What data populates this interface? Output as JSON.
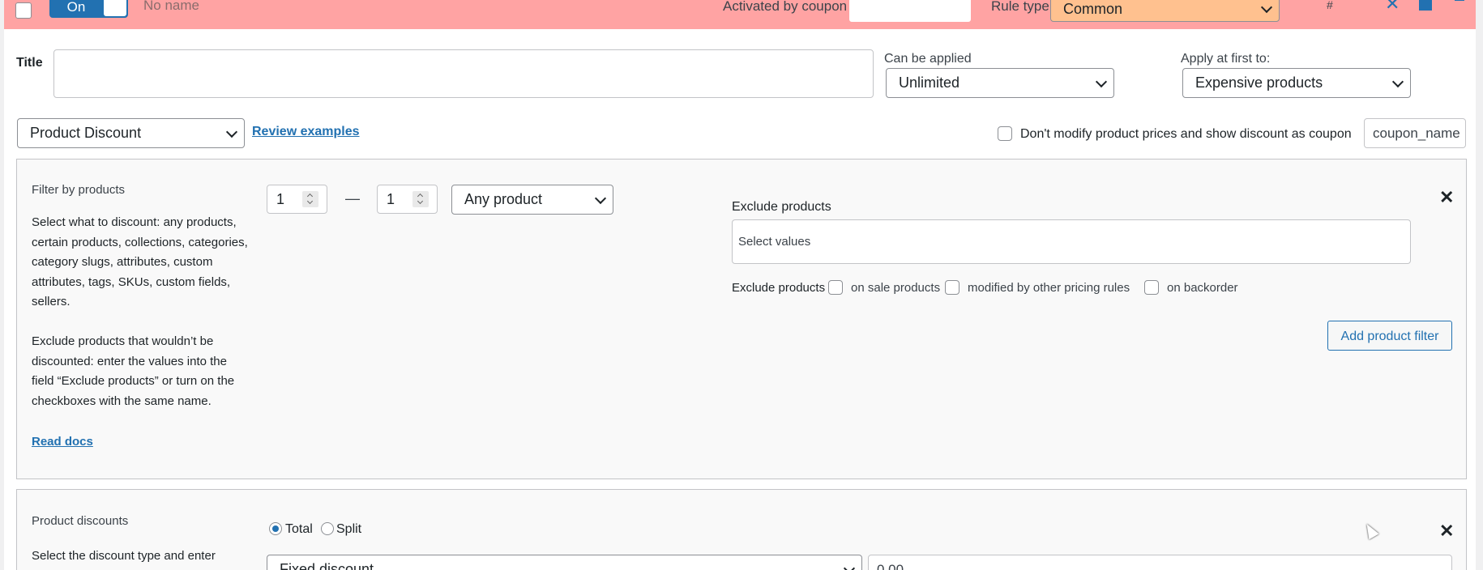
{
  "header": {
    "toggle_label": "On",
    "rule_name_placeholder": "No name",
    "coupon_label": "Activated by coupon",
    "coupon_value": "",
    "rule_type_label": "Rule type",
    "rule_type_value": "Common",
    "hash_label": "#",
    "bg_color": "#ffa3a3",
    "rule_type_bg": "#ffc18f"
  },
  "title_row": {
    "title_label": "Title",
    "title_value": "",
    "can_be_applied_label": "Can be applied",
    "can_be_applied_value": "Unlimited",
    "apply_first_label": "Apply at first to:",
    "apply_first_value": "Expensive products"
  },
  "rule_type_row": {
    "discount_type_value": "Product Discount",
    "review_examples_link": "Review examples",
    "dont_modify_label": "Don't modify product prices and show discount as coupon",
    "coupon_name_value": "coupon_name"
  },
  "filter_section": {
    "title": "Filter by products",
    "desc_1": "Select what to discount: any products, certain products, collections, categories, category slugs, attributes, custom attributes, tags, SKUs, custom fields, sellers.",
    "desc_2": "Exclude products that wouldn’t be discounted: enter the values into the field “Exclude products” or turn on the checkboxes with the same name.",
    "read_docs_link": "Read docs",
    "qty_from": "1",
    "qty_separator": "—",
    "qty_to": "1",
    "product_type_value": "Any product",
    "exclude_label": "Exclude products",
    "exclude_placeholder": "Select values",
    "exclude_checks_label": "Exclude products",
    "on_sale_label": "on sale products",
    "modified_label": "modified by other pricing rules",
    "backorder_label": "on backorder",
    "add_filter_button": "Add product filter"
  },
  "discount_section": {
    "title": "Product discounts",
    "desc": "Select the discount type and enter",
    "radio_total": "Total",
    "radio_split": "Split",
    "discount_type_value": "Fixed discount",
    "amount_value": "0.00"
  },
  "colors": {
    "accent": "#2271b1"
  }
}
